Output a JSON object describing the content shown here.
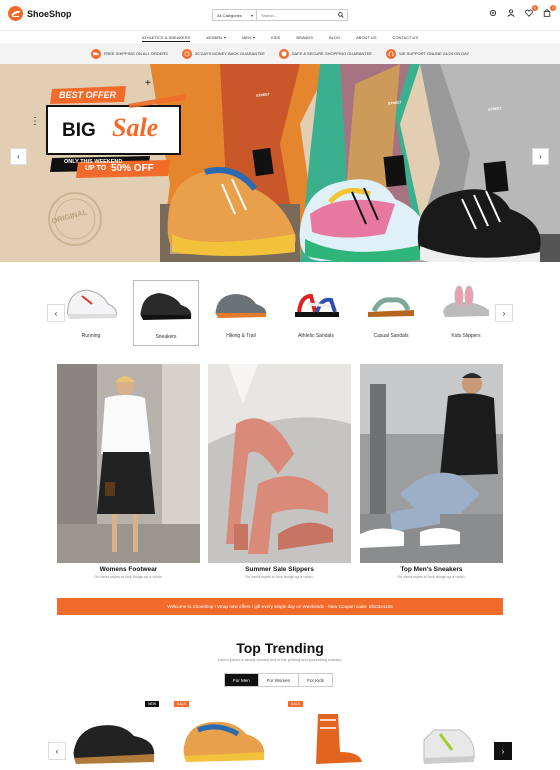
{
  "brand": {
    "name": "ShoeShop"
  },
  "search": {
    "category": "All Categories",
    "placeholder": "Search..."
  },
  "header": {
    "cart_count": "0",
    "wishlist_count": "0"
  },
  "nav": [
    "ATHLETICS & SNEAKERS",
    "WOMEN",
    "MEN",
    "KIDS",
    "BRANDS",
    "BLOG",
    "ABOUT US",
    "CONTACT US"
  ],
  "features": [
    "FREE SHIPPING ON ALL ORDERS",
    "30 DAYS MONEY BACK GUARANTEE",
    "SAFE & SECURE SHOPPING GUARANTEE",
    "WE SUPPORT ONLINE 24/24 ON DAY"
  ],
  "hero": {
    "tag": "BEST OFFER",
    "big": "BIG",
    "sale": "Sale",
    "only": "ONLY THIS WEEKEND",
    "upto": "UP TO",
    "pct": "50% OFF",
    "stamp": "ORIGINAL",
    "shoe_label": "STREET"
  },
  "categories": [
    "Running",
    "Sneakers",
    "Hiking & Trail",
    "Athletic Sandals",
    "Casual Sandals",
    "Kids Slippers"
  ],
  "promos": [
    {
      "title": "Womens Footwear",
      "sub": "On-trend styles to kick things up a notch."
    },
    {
      "title": "Summer Sale Slippers",
      "sub": "On-trend styles to kick things up a notch."
    },
    {
      "title": "Top Men's Sneakers",
      "sub": "On-trend styles to kick things up a notch."
    }
  ],
  "ticker": "Welcome to Shoeshop ! Wrap new offers / gift every single day on Weekends - New Coupon code: Shi03e1105",
  "trending": {
    "title": "Top Trending",
    "sub": "Lorem ipsum is simply dummy text of the printing and typesetting industry.",
    "tabs": [
      "For Men",
      "For Women",
      "For Kids"
    ]
  },
  "products": [
    {
      "badge": "NEW"
    },
    {
      "badge": "SALE"
    },
    {
      "badge": "SALE"
    },
    {
      "badge": ""
    }
  ],
  "colors": {
    "accent": "#f26b2a",
    "dark": "#111111"
  }
}
